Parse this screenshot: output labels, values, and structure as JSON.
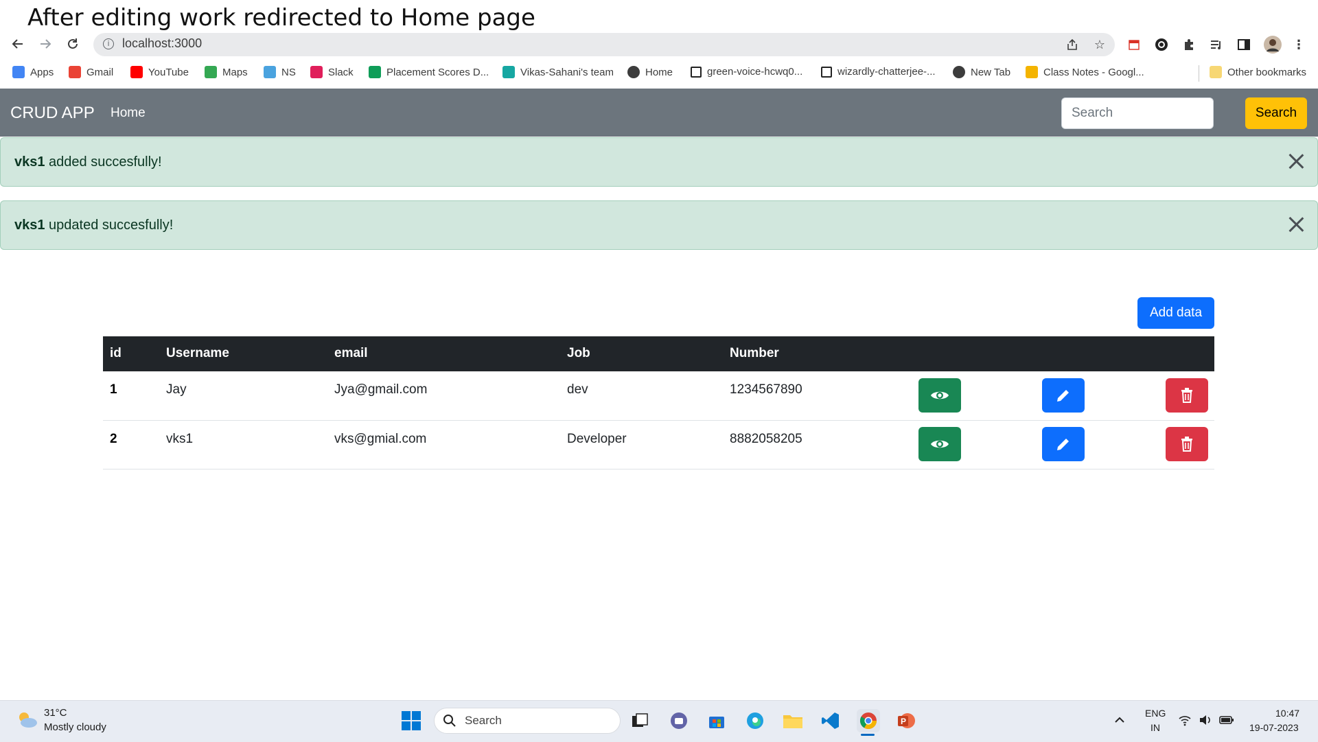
{
  "caption": "After editing work redirected to Home page",
  "browser": {
    "url": "localhost:3000",
    "bookmarks": [
      {
        "label": "Apps",
        "color": "#4285f4"
      },
      {
        "label": "Gmail",
        "color": "#ea4335"
      },
      {
        "label": "YouTube",
        "color": "#ff0000"
      },
      {
        "label": "Maps",
        "color": "#34a853"
      },
      {
        "label": "NS",
        "color": "#4aa3df"
      },
      {
        "label": "Slack",
        "color": "#e01e5a"
      },
      {
        "label": "Placement Scores D...",
        "color": "#0f9d58"
      },
      {
        "label": "Vikas-Sahani's team",
        "color": "#16a7a2"
      },
      {
        "label": "Home",
        "color": "#3c3c3c"
      },
      {
        "label": "green-voice-hcwq0...",
        "color": "#ffffff"
      },
      {
        "label": "wizardly-chatterjee-...",
        "color": "#ffffff"
      },
      {
        "label": "New Tab",
        "color": "#3c3c3c"
      },
      {
        "label": "Class Notes - Googl...",
        "color": "#f4b400"
      }
    ],
    "other_bookmarks": "Other bookmarks"
  },
  "navbar": {
    "brand": "CRUD APP",
    "home_link": "Home",
    "search_placeholder": "Search",
    "search_button": "Search",
    "bg_color": "#6c757d"
  },
  "alerts": [
    {
      "strong": "vks1",
      "message": " added succesfully!"
    },
    {
      "strong": "vks1",
      "message": " updated succesfully!"
    }
  ],
  "add_button": "Add data",
  "table": {
    "headers": [
      "id",
      "Username",
      "email",
      "Job",
      "Number"
    ],
    "rows": [
      {
        "id": "1",
        "username": "Jay",
        "email": "Jya@gmail.com",
        "job": "dev",
        "number": "1234567890"
      },
      {
        "id": "2",
        "username": "vks1",
        "email": "vks@gmial.com",
        "job": "Developer",
        "number": "8882058205"
      }
    ],
    "actions": [
      {
        "name": "view",
        "icon": "eye-icon",
        "color": "#198754"
      },
      {
        "name": "edit",
        "icon": "pencil-icon",
        "color": "#0d6efd"
      },
      {
        "name": "delete",
        "icon": "trash-icon",
        "color": "#dc3545"
      }
    ]
  },
  "taskbar": {
    "weather_temp": "31°C",
    "weather_desc": "Mostly cloudy",
    "search_label": "Search",
    "lang_line1": "ENG",
    "lang_line2": "IN",
    "time": "10:47",
    "date": "19-07-2023"
  }
}
